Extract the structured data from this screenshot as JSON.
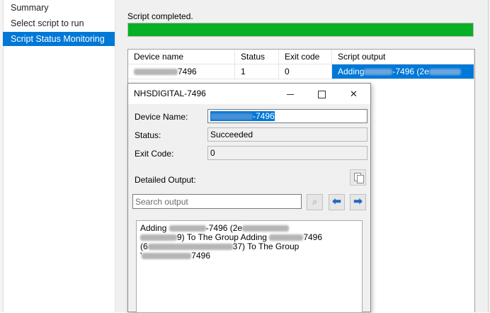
{
  "sidebar": {
    "items": [
      {
        "label": "Summary",
        "active": false
      },
      {
        "label": "Select script to run",
        "active": false
      },
      {
        "label": "Script Status Monitoring",
        "active": true
      }
    ]
  },
  "status": {
    "text": "Script completed.",
    "progress": 1.0,
    "progress_color": "#06b025"
  },
  "grid": {
    "columns": [
      "Device name",
      "Status",
      "Exit code",
      "Script output"
    ],
    "rows": [
      {
        "device_suffix": "7496",
        "status": "1",
        "exit_code": "0",
        "output_prefix": "Adding",
        "output_suffix": "-7496 (2e"
      }
    ]
  },
  "dialog": {
    "title": "NHSDIGITAL-7496",
    "controls": {
      "minimize": "minimize-icon",
      "maximize": "maximize-icon",
      "close": "✕"
    },
    "device_name_label": "Device Name:",
    "device_name_suffix": "-7496",
    "status_label": "Status:",
    "status_value": "Succeeded",
    "exit_code_label": "Exit Code:",
    "exit_code_value": "0",
    "detailed_output_label": "Detailed Output:",
    "search_placeholder": "Search output",
    "find_icon": "⌕",
    "prev_icon": "⬅",
    "next_icon": "➡",
    "output": {
      "line1_a": "Adding",
      "line1_b": "-7496 (2e",
      "line2_a": "9) To The Group Adding",
      "line2_b": "7496",
      "line3_a": "(6",
      "line3_b": "37) To The Group",
      "line4_a": "'",
      "line4_b": "7496"
    }
  },
  "colors": {
    "accent": "#0078d7",
    "window_bg": "#f0f0f0"
  }
}
